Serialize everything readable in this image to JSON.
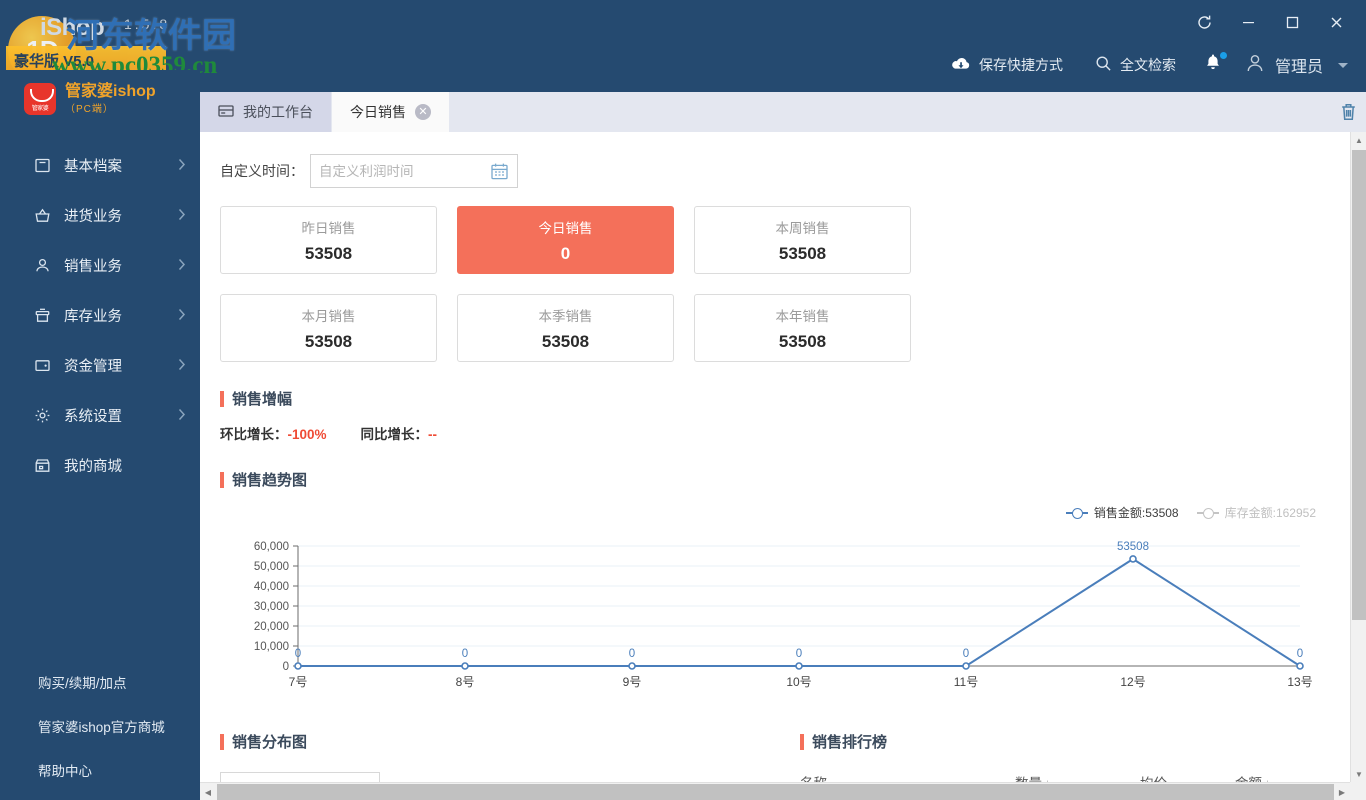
{
  "window": {
    "watermark_app": "iShop",
    "watermark_version": "1.5.8",
    "watermark_ribbon": "豪华版 V5.0",
    "watermark_site_cn": "河东软件园",
    "watermark_site_url": "www.pc0359.cn",
    "controls": {
      "refresh": "refresh-icon",
      "minimize": "minimize-icon",
      "maximize": "maximize-icon",
      "close": "close-icon"
    }
  },
  "header": {
    "save_shortcut": "保存快捷方式",
    "full_search": "全文检索",
    "notifications": "notification-bell",
    "user_name": "管理员"
  },
  "brand": {
    "name": "管家婆ishop",
    "sub": "（PC端）"
  },
  "sidebar": {
    "items": [
      {
        "label": "基本档案",
        "icon": "file-archive-icon",
        "has_chevron": true
      },
      {
        "label": "进货业务",
        "icon": "purchase-basket-icon",
        "has_chevron": true
      },
      {
        "label": "销售业务",
        "icon": "user-sales-icon",
        "has_chevron": true
      },
      {
        "label": "库存业务",
        "icon": "inventory-box-icon",
        "has_chevron": true
      },
      {
        "label": "资金管理",
        "icon": "wallet-icon",
        "has_chevron": true
      },
      {
        "label": "系统设置",
        "icon": "gear-icon",
        "has_chevron": true
      },
      {
        "label": "我的商城",
        "icon": "store-icon",
        "has_chevron": false
      }
    ],
    "links": [
      "购买/续期/加点",
      "管家婆ishop官方商城",
      "帮助中心"
    ]
  },
  "tabs": [
    {
      "label": "我的工作台",
      "icon": "workbench-icon",
      "active": false,
      "closable": false
    },
    {
      "label": "今日销售",
      "icon": "",
      "active": true,
      "closable": true
    }
  ],
  "tabbar": {
    "trash": "trash-icon"
  },
  "main": {
    "date_filter": {
      "label": "自定义时间：",
      "placeholder": "自定义利润时间",
      "value": "",
      "calendar_icon": "calendar-icon"
    },
    "cards": [
      {
        "title": "昨日销售",
        "value": "53508",
        "active": false
      },
      {
        "title": "今日销售",
        "value": "0",
        "active": true
      },
      {
        "title": "本周销售",
        "value": "53508",
        "active": false
      },
      {
        "title": "本月销售",
        "value": "53508",
        "active": false
      },
      {
        "title": "本季销售",
        "value": "53508",
        "active": false
      },
      {
        "title": "本年销售",
        "value": "53508",
        "active": false
      }
    ],
    "growth_section": {
      "title": "销售增幅",
      "mom_label": "环比增长：",
      "mom_value": "-100%",
      "yoy_label": "同比增长：",
      "yoy_value": "--"
    },
    "trend_section": {
      "title": "销售趋势图"
    },
    "distribution_section": {
      "title": "销售分布图"
    },
    "ranking_section": {
      "title": "销售排行榜",
      "columns": [
        {
          "label": "名称",
          "sortable": false
        },
        {
          "label": "数量",
          "sortable": true
        },
        {
          "label": "均价",
          "sortable": false
        },
        {
          "label": "金额",
          "sortable": true
        }
      ],
      "rows": []
    }
  },
  "colors": {
    "header_blue": "#254A70",
    "accent_orange": "#F4705A",
    "line_blue": "#4A7EBB",
    "tab_inactive": "#D4D7E8",
    "tabbar_bg": "#E4E7F0",
    "brand_gold": "#F0A32A"
  },
  "chart_data": {
    "type": "line",
    "title": "销售趋势图",
    "xlabel": "",
    "ylabel": "",
    "categories": [
      "7号",
      "8号",
      "9号",
      "10号",
      "11号",
      "12号",
      "13号"
    ],
    "series": [
      {
        "name": "销售金额:53508",
        "legend_label": "销售金额:53508",
        "color": "#4A7EBB",
        "visible": true,
        "values": [
          0,
          0,
          0,
          0,
          0,
          53508,
          0
        ],
        "point_labels": [
          "0",
          "0",
          "0",
          "0",
          "0",
          "53508",
          "0"
        ]
      },
      {
        "name": "库存金额:162952",
        "legend_label": "库存金额:162952",
        "color": "#C4C4C4",
        "visible": false,
        "values": []
      }
    ],
    "ylim": [
      0,
      60000
    ],
    "yticks": [
      0,
      10000,
      20000,
      30000,
      40000,
      50000,
      60000
    ],
    "ytick_labels": [
      "0",
      "10,000",
      "20,000",
      "30,000",
      "40,000",
      "50,000",
      "60,000"
    ],
    "grid": true,
    "legend_position": "top-right"
  }
}
